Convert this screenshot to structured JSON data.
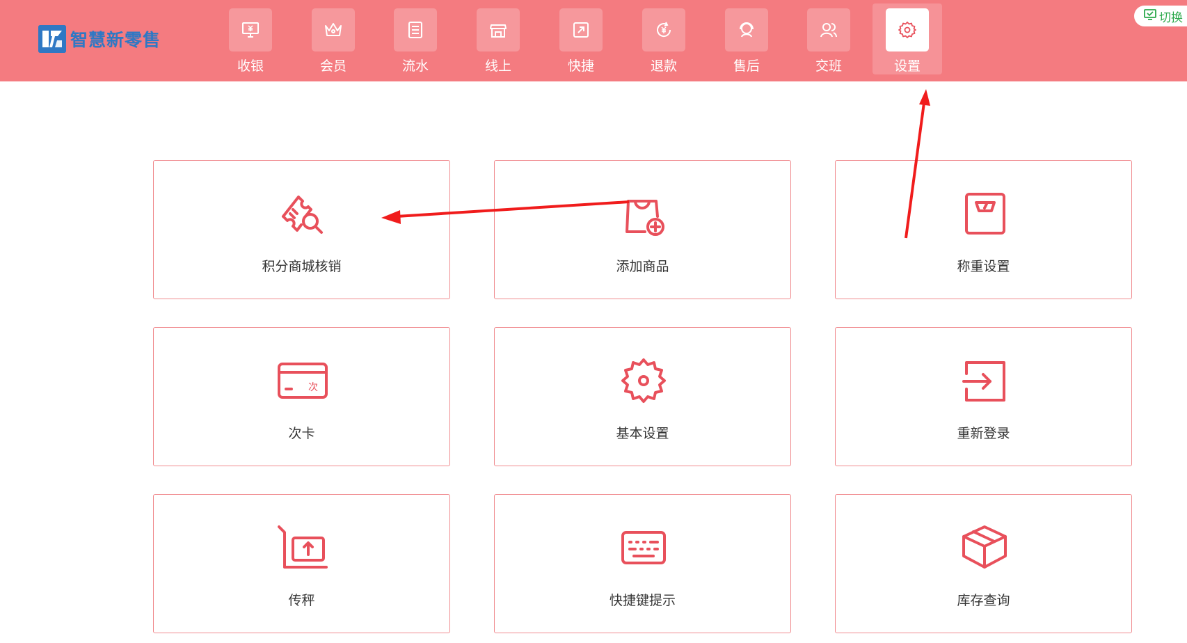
{
  "app": {
    "logo_text": "智慧新零售",
    "switch_label": "切换"
  },
  "colors": {
    "topbar": "#f47b80",
    "accent": "#e8505b",
    "logo_blue": "#2f78c4",
    "annotation_arrow": "#f01c1c"
  },
  "nav": {
    "items": [
      {
        "label": "收银",
        "icon": "cashier-monitor-icon"
      },
      {
        "label": "会员",
        "icon": "crown-icon"
      },
      {
        "label": "流水",
        "icon": "ledger-icon"
      },
      {
        "label": "线上",
        "icon": "store-icon"
      },
      {
        "label": "快捷",
        "icon": "shortcut-icon"
      },
      {
        "label": "退款",
        "icon": "refund-icon"
      },
      {
        "label": "售后",
        "icon": "headset-icon"
      },
      {
        "label": "交班",
        "icon": "users-icon"
      },
      {
        "label": "设置",
        "icon": "gear-icon",
        "active": true
      }
    ]
  },
  "tiles": [
    {
      "label": "积分商城核销",
      "icon": "coupon-search-icon"
    },
    {
      "label": "添加商品",
      "icon": "bag-add-icon"
    },
    {
      "label": "称重设置",
      "icon": "scale-icon"
    },
    {
      "label": "次卡",
      "icon": "card-icon",
      "icon_text": "次"
    },
    {
      "label": "基本设置",
      "icon": "gear-icon"
    },
    {
      "label": "重新登录",
      "icon": "login-icon"
    },
    {
      "label": "传秤",
      "icon": "upload-scale-icon"
    },
    {
      "label": "快捷键提示",
      "icon": "keyboard-icon"
    },
    {
      "label": "库存查询",
      "icon": "box-icon"
    }
  ]
}
